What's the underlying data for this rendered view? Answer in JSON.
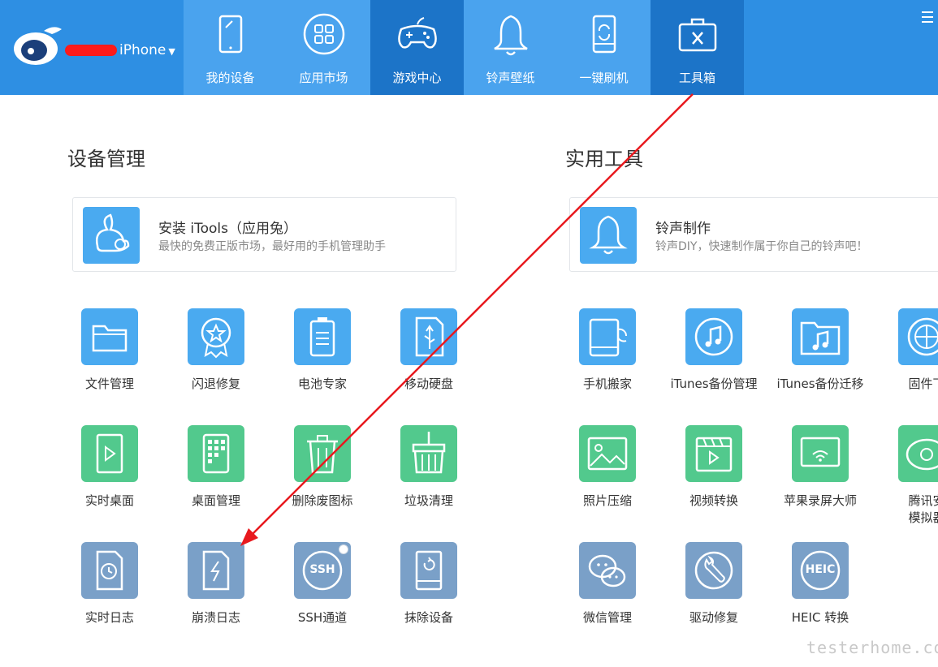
{
  "header": {
    "device_label": "iPhone",
    "tabs": [
      {
        "label": "我的设备",
        "icon": "tablet-icon"
      },
      {
        "label": "应用市场",
        "icon": "apps-grid-icon"
      },
      {
        "label": "游戏中心",
        "icon": "gamepad-icon"
      },
      {
        "label": "铃声壁纸",
        "icon": "bell-icon"
      },
      {
        "label": "一键刷机",
        "icon": "phone-refresh-icon"
      },
      {
        "label": "工具箱",
        "icon": "toolbox-icon"
      }
    ],
    "active_tab": "工具箱"
  },
  "left": {
    "title": "设备管理",
    "card": {
      "title": "安装 iTools（应用兔）",
      "subtitle": "最快的免费正版市场，最好用的手机管理助手"
    },
    "tiles": [
      {
        "label": "文件管理",
        "icon": "folder-icon",
        "color": "blue"
      },
      {
        "label": "闪退修复",
        "icon": "badge-star-icon",
        "color": "blue"
      },
      {
        "label": "电池专家",
        "icon": "battery-icon",
        "color": "blue"
      },
      {
        "label": "移动硬盘",
        "icon": "usb-drive-icon",
        "color": "blue"
      },
      {
        "label": "实时桌面",
        "icon": "play-screen-icon",
        "color": "green"
      },
      {
        "label": "桌面管理",
        "icon": "desktop-grid-icon",
        "color": "green"
      },
      {
        "label": "删除废图标",
        "icon": "trash-icon",
        "color": "green"
      },
      {
        "label": "垃圾清理",
        "icon": "broom-icon",
        "color": "green"
      },
      {
        "label": "实时日志",
        "icon": "clock-doc-icon",
        "color": "slate"
      },
      {
        "label": "崩溃日志",
        "icon": "crash-doc-icon",
        "color": "slate"
      },
      {
        "label": "SSH通道",
        "icon": "ssh-icon",
        "color": "slate"
      },
      {
        "label": "抹除设备",
        "icon": "erase-device-icon",
        "color": "slate"
      }
    ]
  },
  "right": {
    "title": "实用工具",
    "card": {
      "title": "铃声制作",
      "subtitle": "铃声DIY，快速制作属于你自己的铃声吧！"
    },
    "tiles": [
      {
        "label": "手机搬家",
        "icon": "phone-transfer-icon",
        "color": "blue"
      },
      {
        "label": "iTunes备份管理",
        "icon": "music-backup-icon",
        "color": "blue"
      },
      {
        "label": "iTunes备份迁移",
        "icon": "music-folder-icon",
        "color": "blue"
      },
      {
        "label": "固件下",
        "icon": "firmware-icon",
        "color": "blue"
      },
      {
        "label": "照片压缩",
        "icon": "photo-icon",
        "color": "green"
      },
      {
        "label": "视频转换",
        "icon": "video-icon",
        "color": "green"
      },
      {
        "label": "苹果录屏大师",
        "icon": "airplay-icon",
        "color": "green"
      },
      {
        "label": "腾讯安\n模拟器",
        "icon": "emulator-icon",
        "color": "green"
      },
      {
        "label": "微信管理",
        "icon": "wechat-icon",
        "color": "slate"
      },
      {
        "label": "驱动修复",
        "icon": "wrench-icon",
        "color": "slate"
      },
      {
        "label": "HEIC 转换",
        "icon": "heic-icon",
        "color": "slate"
      }
    ]
  },
  "badges": {
    "ssh_text": "SSH",
    "heic_text": "HEIC"
  },
  "watermark": "testerhome.com"
}
